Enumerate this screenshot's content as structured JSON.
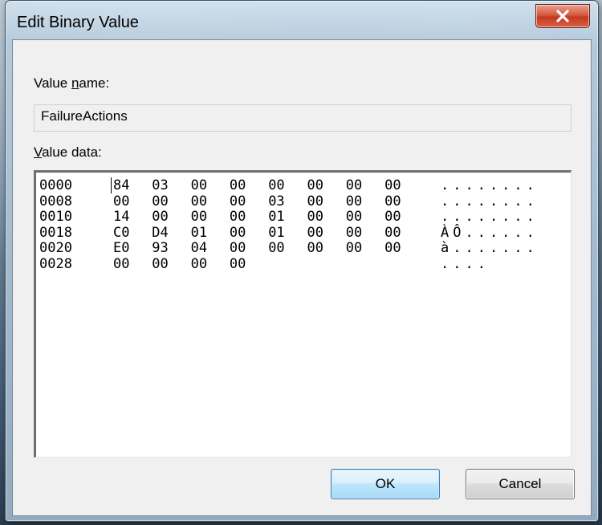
{
  "window": {
    "title": "Edit Binary Value",
    "close_glyph": "close-icon"
  },
  "value_name": {
    "label_pre": "Value ",
    "label_accel": "n",
    "label_post": "ame:",
    "value": "FailureActions"
  },
  "value_data": {
    "label_accel": "V",
    "label_post": "alue data:",
    "rows": [
      {
        "offset": "0000",
        "bytes": [
          "84",
          "03",
          "00",
          "00",
          "00",
          "00",
          "00",
          "00"
        ],
        "ascii": "........"
      },
      {
        "offset": "0008",
        "bytes": [
          "00",
          "00",
          "00",
          "00",
          "03",
          "00",
          "00",
          "00"
        ],
        "ascii": "........"
      },
      {
        "offset": "0010",
        "bytes": [
          "14",
          "00",
          "00",
          "00",
          "01",
          "00",
          "00",
          "00"
        ],
        "ascii": "........"
      },
      {
        "offset": "0018",
        "bytes": [
          "C0",
          "D4",
          "01",
          "00",
          "01",
          "00",
          "00",
          "00"
        ],
        "ascii": "ÀÔ......"
      },
      {
        "offset": "0020",
        "bytes": [
          "E0",
          "93",
          "04",
          "00",
          "00",
          "00",
          "00",
          "00"
        ],
        "ascii": "à......."
      },
      {
        "offset": "0028",
        "bytes": [
          "00",
          "00",
          "00",
          "00"
        ],
        "ascii": "...."
      }
    ]
  },
  "buttons": {
    "ok": "OK",
    "cancel": "Cancel"
  },
  "colors": {
    "close_button": "#c3381f",
    "ok_button_border": "#3c7fb1"
  }
}
